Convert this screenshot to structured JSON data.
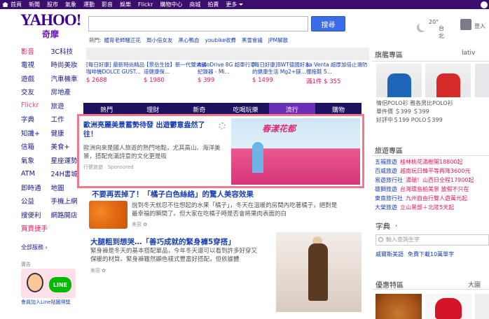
{
  "topbar": {
    "items": [
      "首頁",
      "新聞",
      "股市",
      "氣象",
      "運動",
      "影音",
      "娛樂",
      "Flickr",
      "購物中心",
      "商城",
      "拍賣",
      "更多"
    ]
  },
  "header": {
    "logo": "YAHOO!",
    "logo_sub": "奇摩",
    "search_button": "搜尋",
    "hot_label": "熱門:",
    "hot_keywords": [
      "體育老師騷正花",
      "周小倍女友",
      "黑心鴨血",
      "youbike收費",
      "黑雪會議",
      "JPM解散"
    ],
    "weather_temp": "20°",
    "weather_city": "台北",
    "user_label": "登入"
  },
  "nav": {
    "rows": [
      [
        "影音",
        "3C科技"
      ],
      [
        "電視",
        "時尚美妝"
      ],
      [
        "遊戲",
        "汽車機車"
      ],
      [
        "交友",
        "房地產"
      ],
      [
        "Flickr",
        "旅遊"
      ],
      [
        "字典",
        "工作"
      ],
      [
        "知識+",
        "健康"
      ],
      [
        "信箱",
        "美食+"
      ],
      [
        "氣象",
        "星座運勢"
      ],
      [
        "ATM",
        "24H書城"
      ],
      [
        "即時通",
        "地圖"
      ],
      [
        "公益",
        "手機上網"
      ],
      [
        "搜便利",
        "網路開店"
      ],
      [
        "買賣捷手",
        ""
      ]
    ],
    "all_label": "全部服務 ›",
    "ad_label": "廣告",
    "ad_badge": "LINE",
    "ad_text": "會員加入Line貼圖得獎"
  },
  "carousel": [
    {
      "title": "[每日好康] 最新時尚精品咖啡機DOLCE GUST...",
      "price": "$ 2688"
    },
    {
      "title": "【景岳生技】新一代雙效腸道健康保...",
      "price": "$ 1980"
    },
    {
      "title": "AutoDrive 8G 超車行車紀錄器 - Mi...",
      "price": "$ 399"
    },
    {
      "title": "[每日好康]BWT德國好水的健康生活 Mg2+鎂...",
      "price": "$ 1499"
    },
    {
      "title": "La Venta 超厚加倍止滑防撞拖鞋 5...",
      "price": "滿1件 $ 355"
    }
  ],
  "tabs": [
    "熱門",
    "理財",
    "新奇",
    "吃喝玩樂",
    "流行",
    "購物"
  ],
  "sponsored": {
    "title": "歐洲亮麗美景蓄勢待發 出遊鬱意盎然了往！",
    "desc": "歐洲向來是國人旅遊的熱門地點，尤其高山、海洋美景，搭配充滿詩意的文化更是吸",
    "source": "行健旅遊",
    "tag": "Sponsored",
    "image_caption": "春漾花都"
  },
  "articles": [
    {
      "title": "不要再丟掉了！「橘子白色絲絡」的驚人美容效果",
      "desc": "說到冬天就忍不住想起的水果「橘子」，冬天在溫暖的房間內吃著橘子，絕對是最幸福的瞬間了。但大家在吃橘子時是否會將果肉表面的白",
      "source": "美容 ✿"
    },
    {
      "title": "大腿粗到想哭…「善巧成就的緊身褲5穿搭」",
      "desc": "緊身褲是冬天的基本搭配單品，今年冬天還可以看到許多好穿又保暖的材質。緊身褲雖然顯色樣式豐富好搭配，但依據體",
      "source": "美容 ✿"
    }
  ],
  "rail": {
    "shop_title": "旗艦專區",
    "shop_sub": "lativ",
    "shop_lines": [
      "情侶POLO衫 雅各男比POLO衫",
      "單件價 ＄399 ＄399",
      "好評中＄199 POLO＄399"
    ],
    "travel_title": "旅遊專區",
    "travel_items": [
      {
        "k": "五福旅遊",
        "v": "桂林桃花滿樹開18800起"
      },
      {
        "k": "百威旅遊",
        "v": "越南玩日韓平等再降3600元"
      },
      {
        "k": "易遊旅行社",
        "v": "湯瑞！山西日全程17900起"
      },
      {
        "k": "雄獅旅遊",
        "v": "台灣環島拍美景 放假不只在"
      },
      {
        "k": "東南旅行社",
        "v": "九州自由行雙人遊萬元起"
      },
      {
        "k": "大榮旅遊",
        "v": "立山黑部＋北陸5天起"
      }
    ],
    "dict_title": "字典",
    "dict_placeholder": "輸入查詢生字",
    "dict_link_a": "威爾斯美語",
    "dict_link_b": "免費下載10萬單字",
    "deal_title": "優惠特區",
    "deal_tail": "大園"
  },
  "colors": {
    "topbar": "#3b0d6c",
    "brand": "#400090",
    "tab_bar": "#1d1262",
    "tab_active": "#6b2eb8",
    "highlight_border": "#f07a8a",
    "price": "#e0195a",
    "link": "#1a3fb0"
  }
}
